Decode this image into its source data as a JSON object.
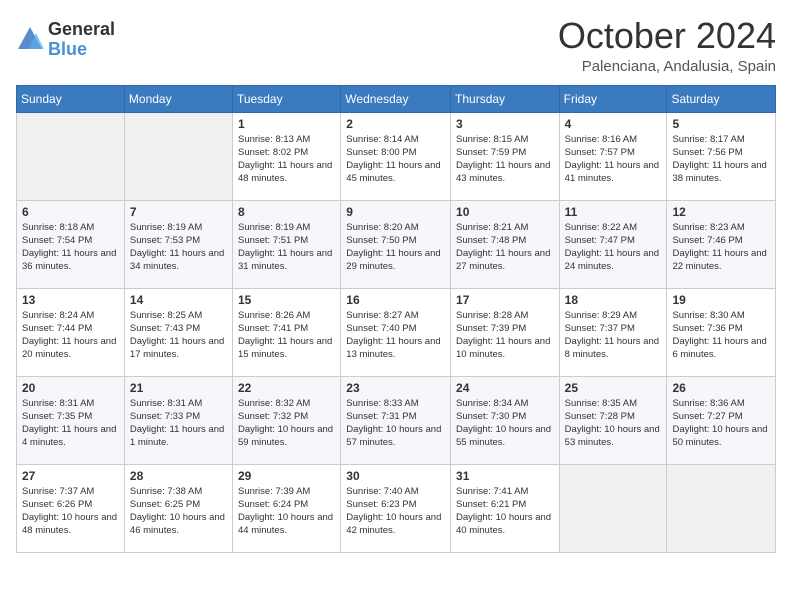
{
  "header": {
    "logo_general": "General",
    "logo_blue": "Blue",
    "month_title": "October 2024",
    "location": "Palenciana, Andalusia, Spain"
  },
  "calendar": {
    "days_of_week": [
      "Sunday",
      "Monday",
      "Tuesday",
      "Wednesday",
      "Thursday",
      "Friday",
      "Saturday"
    ],
    "weeks": [
      [
        {
          "day": "",
          "info": ""
        },
        {
          "day": "",
          "info": ""
        },
        {
          "day": "1",
          "info": "Sunrise: 8:13 AM\nSunset: 8:02 PM\nDaylight: 11 hours and 48 minutes."
        },
        {
          "day": "2",
          "info": "Sunrise: 8:14 AM\nSunset: 8:00 PM\nDaylight: 11 hours and 45 minutes."
        },
        {
          "day": "3",
          "info": "Sunrise: 8:15 AM\nSunset: 7:59 PM\nDaylight: 11 hours and 43 minutes."
        },
        {
          "day": "4",
          "info": "Sunrise: 8:16 AM\nSunset: 7:57 PM\nDaylight: 11 hours and 41 minutes."
        },
        {
          "day": "5",
          "info": "Sunrise: 8:17 AM\nSunset: 7:56 PM\nDaylight: 11 hours and 38 minutes."
        }
      ],
      [
        {
          "day": "6",
          "info": "Sunrise: 8:18 AM\nSunset: 7:54 PM\nDaylight: 11 hours and 36 minutes."
        },
        {
          "day": "7",
          "info": "Sunrise: 8:19 AM\nSunset: 7:53 PM\nDaylight: 11 hours and 34 minutes."
        },
        {
          "day": "8",
          "info": "Sunrise: 8:19 AM\nSunset: 7:51 PM\nDaylight: 11 hours and 31 minutes."
        },
        {
          "day": "9",
          "info": "Sunrise: 8:20 AM\nSunset: 7:50 PM\nDaylight: 11 hours and 29 minutes."
        },
        {
          "day": "10",
          "info": "Sunrise: 8:21 AM\nSunset: 7:48 PM\nDaylight: 11 hours and 27 minutes."
        },
        {
          "day": "11",
          "info": "Sunrise: 8:22 AM\nSunset: 7:47 PM\nDaylight: 11 hours and 24 minutes."
        },
        {
          "day": "12",
          "info": "Sunrise: 8:23 AM\nSunset: 7:46 PM\nDaylight: 11 hours and 22 minutes."
        }
      ],
      [
        {
          "day": "13",
          "info": "Sunrise: 8:24 AM\nSunset: 7:44 PM\nDaylight: 11 hours and 20 minutes."
        },
        {
          "day": "14",
          "info": "Sunrise: 8:25 AM\nSunset: 7:43 PM\nDaylight: 11 hours and 17 minutes."
        },
        {
          "day": "15",
          "info": "Sunrise: 8:26 AM\nSunset: 7:41 PM\nDaylight: 11 hours and 15 minutes."
        },
        {
          "day": "16",
          "info": "Sunrise: 8:27 AM\nSunset: 7:40 PM\nDaylight: 11 hours and 13 minutes."
        },
        {
          "day": "17",
          "info": "Sunrise: 8:28 AM\nSunset: 7:39 PM\nDaylight: 11 hours and 10 minutes."
        },
        {
          "day": "18",
          "info": "Sunrise: 8:29 AM\nSunset: 7:37 PM\nDaylight: 11 hours and 8 minutes."
        },
        {
          "day": "19",
          "info": "Sunrise: 8:30 AM\nSunset: 7:36 PM\nDaylight: 11 hours and 6 minutes."
        }
      ],
      [
        {
          "day": "20",
          "info": "Sunrise: 8:31 AM\nSunset: 7:35 PM\nDaylight: 11 hours and 4 minutes."
        },
        {
          "day": "21",
          "info": "Sunrise: 8:31 AM\nSunset: 7:33 PM\nDaylight: 11 hours and 1 minute."
        },
        {
          "day": "22",
          "info": "Sunrise: 8:32 AM\nSunset: 7:32 PM\nDaylight: 10 hours and 59 minutes."
        },
        {
          "day": "23",
          "info": "Sunrise: 8:33 AM\nSunset: 7:31 PM\nDaylight: 10 hours and 57 minutes."
        },
        {
          "day": "24",
          "info": "Sunrise: 8:34 AM\nSunset: 7:30 PM\nDaylight: 10 hours and 55 minutes."
        },
        {
          "day": "25",
          "info": "Sunrise: 8:35 AM\nSunset: 7:28 PM\nDaylight: 10 hours and 53 minutes."
        },
        {
          "day": "26",
          "info": "Sunrise: 8:36 AM\nSunset: 7:27 PM\nDaylight: 10 hours and 50 minutes."
        }
      ],
      [
        {
          "day": "27",
          "info": "Sunrise: 7:37 AM\nSunset: 6:26 PM\nDaylight: 10 hours and 48 minutes."
        },
        {
          "day": "28",
          "info": "Sunrise: 7:38 AM\nSunset: 6:25 PM\nDaylight: 10 hours and 46 minutes."
        },
        {
          "day": "29",
          "info": "Sunrise: 7:39 AM\nSunset: 6:24 PM\nDaylight: 10 hours and 44 minutes."
        },
        {
          "day": "30",
          "info": "Sunrise: 7:40 AM\nSunset: 6:23 PM\nDaylight: 10 hours and 42 minutes."
        },
        {
          "day": "31",
          "info": "Sunrise: 7:41 AM\nSunset: 6:21 PM\nDaylight: 10 hours and 40 minutes."
        },
        {
          "day": "",
          "info": ""
        },
        {
          "day": "",
          "info": ""
        }
      ]
    ]
  }
}
